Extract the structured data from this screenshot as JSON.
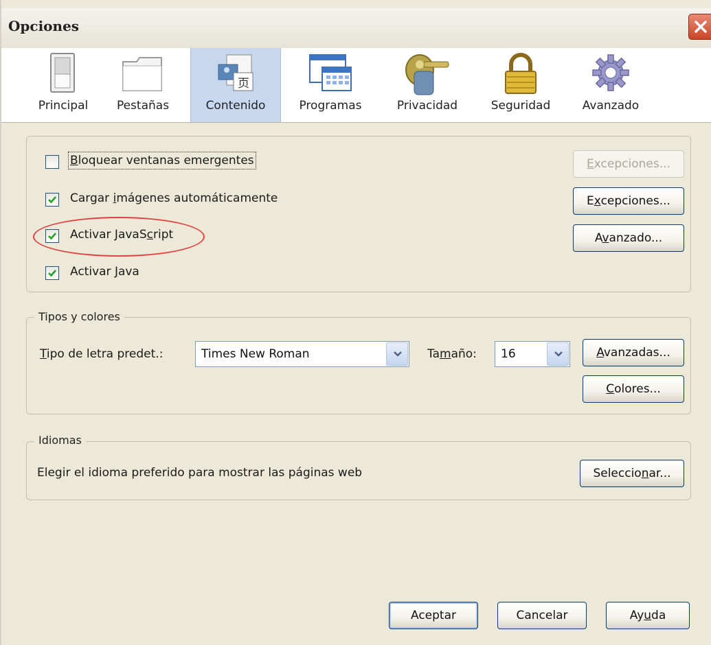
{
  "window": {
    "title": "Opciones"
  },
  "toolbar": {
    "tabs": [
      {
        "label": "Principal",
        "icon": "switch-icon"
      },
      {
        "label": "Pestañas",
        "icon": "folder-tabs-icon"
      },
      {
        "label": "Contenido",
        "icon": "content-icon",
        "active": true
      },
      {
        "label": "Programas",
        "icon": "applications-icon"
      },
      {
        "label": "Privacidad",
        "icon": "mask-key-icon"
      },
      {
        "label": "Seguridad",
        "icon": "padlock-icon"
      },
      {
        "label": "Avanzado",
        "icon": "gear-icon"
      }
    ]
  },
  "content": {
    "popups": {
      "pre": "",
      "key": "B",
      "post": "loquear ventanas emergentes",
      "checked": false
    },
    "images": {
      "pre": "Cargar ",
      "key": "i",
      "post": "mágenes automáticamente",
      "checked": true
    },
    "javascript": {
      "pre": "Activar JavaS",
      "key": "c",
      "post": "ript",
      "checked": true
    },
    "java": {
      "pre": "Activar ",
      "key": "J",
      "post": "ava",
      "checked": true
    },
    "exceptions1": {
      "pre": "",
      "key": "E",
      "post": "xcepciones..."
    },
    "exceptions2": {
      "pre": "E",
      "key": "x",
      "post": "cepciones..."
    },
    "advanced": {
      "pre": "A",
      "key": "v",
      "post": "anzado..."
    }
  },
  "fonts": {
    "legend": "Tipos y colores",
    "default_font_label": {
      "pre": "",
      "key": "T",
      "post": "ipo de letra predet.:"
    },
    "default_font_value": "Times New Roman",
    "size_label": {
      "pre": "Ta",
      "key": "m",
      "post": "año:"
    },
    "size_value": "16",
    "advanced_btn": {
      "pre": "",
      "key": "A",
      "post": "vanzadas..."
    },
    "colors_btn": {
      "pre": "",
      "key": "C",
      "post": "olores..."
    }
  },
  "languages": {
    "legend": "Idiomas",
    "description": "Elegir el idioma preferido para mostrar las páginas web",
    "select_btn": {
      "pre": "Seleccio",
      "key": "n",
      "post": "ar..."
    }
  },
  "footer": {
    "ok": "Aceptar",
    "cancel": "Cancelar",
    "help": {
      "pre": "Ay",
      "key": "u",
      "post": "da"
    }
  },
  "colors": {
    "annotation_ellipse": "#e04040",
    "active_tab": "#c7d7ee",
    "dialog_bg": "#ece9d8"
  }
}
